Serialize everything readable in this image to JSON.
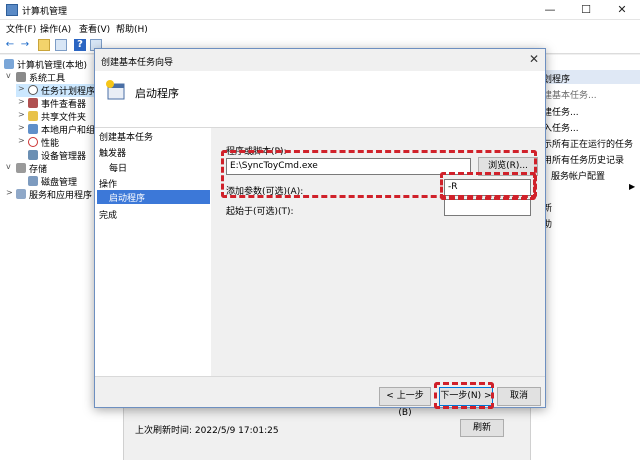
{
  "window": {
    "title": "计算机管理"
  },
  "menu": [
    "文件(F)",
    "操作(A)",
    "查看(V)",
    "帮助(H)"
  ],
  "toolbar": {
    "back": "←",
    "forward": "→"
  },
  "tree": {
    "root": "计算机管理(本地)",
    "system_tools": "系统工具",
    "task_scheduler": "任务计划程序",
    "event_viewer": "事件查看器",
    "shared_folders": "共享文件夹",
    "local_users": "本地用户和组",
    "performance": "性能",
    "device_manager": "设备管理器",
    "storage": "存储",
    "disk_management": "磁盘管理",
    "services_apps": "服务和应用程序"
  },
  "actions": {
    "header": "划程序",
    "items": [
      "建基本任务...",
      "建任务...",
      "入任务...",
      "示所有正在运行的任务",
      "用所有任务历史记录",
      "服务帐户配置",
      "",
      "新",
      "助"
    ]
  },
  "status": {
    "last_run": "上次刷新时间: 2022/5/9 17:01:25",
    "refresh": "刷新"
  },
  "dialog": {
    "title": "创建基本任务向导",
    "heading": "启动程序",
    "steps": {
      "create": "创建基本任务",
      "trigger": "触发器",
      "daily": "每日",
      "action": "操作",
      "start_program": "启动程序",
      "finish": "完成"
    },
    "form": {
      "program_label": "程序或脚本(P):",
      "program_value": "E:\\SyncToyCmd.exe",
      "browse": "浏览(R)...",
      "args_label": "添加参数(可选)(A):",
      "args_value": "-R",
      "startin_label": "起始于(可选)(T):",
      "startin_value": ""
    },
    "buttons": {
      "back": "< 上一步(B)",
      "next": "下一步(N) >",
      "cancel": "取消"
    }
  },
  "colors": {
    "highlight": "#d0212a",
    "selection": "#3c78d8"
  }
}
